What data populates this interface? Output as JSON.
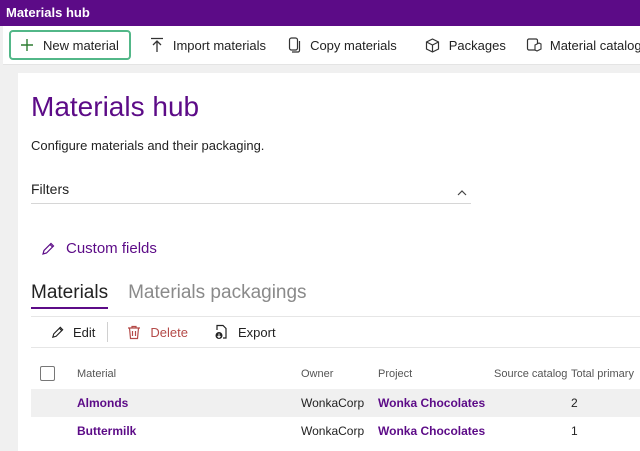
{
  "window": {
    "title": "Materials hub"
  },
  "toolbar": {
    "new_material": "New material",
    "import_materials": "Import materials",
    "copy_materials": "Copy materials",
    "packages": "Packages",
    "material_catalogs": "Material catalogs"
  },
  "page": {
    "title": "Materials hub",
    "subtitle": "Configure materials and their packaging."
  },
  "filters": {
    "label": "Filters"
  },
  "custom_fields": {
    "label": "Custom fields"
  },
  "tabs": [
    {
      "label": "Materials",
      "active": true
    },
    {
      "label": "Materials packagings",
      "active": false
    }
  ],
  "actions": {
    "edit": "Edit",
    "delete": "Delete",
    "export": "Export"
  },
  "table": {
    "columns": {
      "material": "Material",
      "owner": "Owner",
      "project": "Project",
      "source_catalog": "Source catalog",
      "total_primary": "Total primary"
    },
    "rows": [
      {
        "material": "Almonds",
        "owner": "WonkaCorp",
        "project": "Wonka Chocolates",
        "source_catalog": "",
        "total_primary": "2"
      },
      {
        "material": "Buttermilk",
        "owner": "WonkaCorp",
        "project": "Wonka Chocolates",
        "source_catalog": "",
        "total_primary": "1"
      }
    ]
  },
  "colors": {
    "brand": "#5c0b87",
    "highlight_border": "#52b788",
    "danger": "#b44a48"
  }
}
